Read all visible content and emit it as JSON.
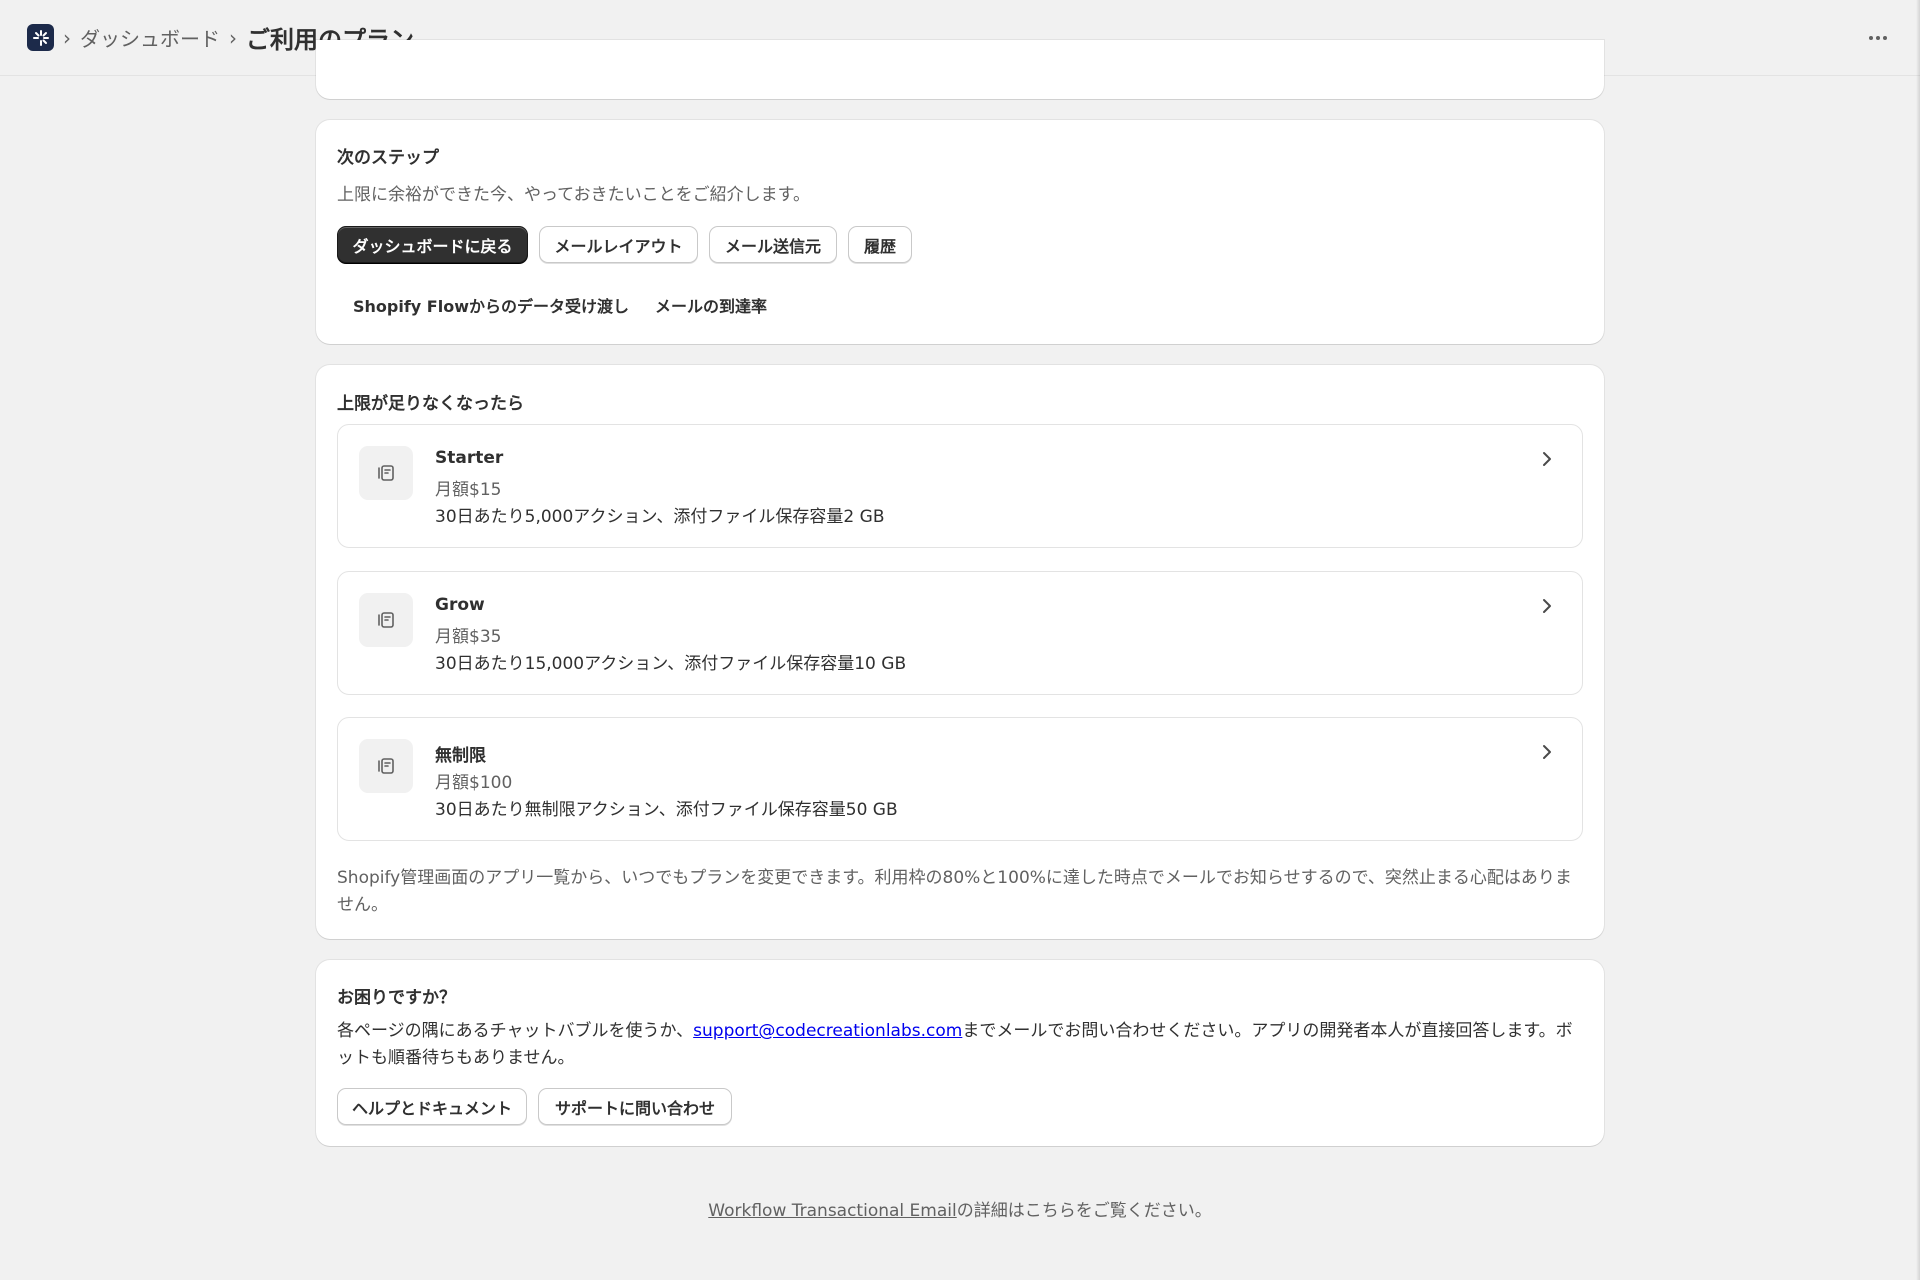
{
  "header": {
    "breadcrumb_parent": "ダッシュボード",
    "page_title": "ご利用のプラン"
  },
  "next_steps": {
    "title": "次のステップ",
    "subtitle": "上限に余裕ができた今、やっておきたいことをご紹介します。",
    "buttons": [
      "ダッシュボードに戻る",
      "メールレイアウト",
      "メール送信元",
      "履歴"
    ],
    "links": [
      "Shopify Flowからのデータ受け渡し",
      "メールの到達率"
    ]
  },
  "upgrade": {
    "title": "上限が足りなくなったら",
    "plans": [
      {
        "name": "Starter",
        "price": "月額$15",
        "desc": "30日あたり5,000アクション、添付ファイル保存容量2 GB"
      },
      {
        "name": "Grow",
        "price": "月額$35",
        "desc": "30日あたり15,000アクション、添付ファイル保存容量10 GB"
      },
      {
        "name": "無制限",
        "price": "月額$100",
        "desc": "30日あたり無制限アクション、添付ファイル保存容量50 GB"
      }
    ],
    "note": "Shopify管理画面のアプリ一覧から、いつでもプランを変更できます。利用枠の80%と100%に達した時点でメールでお知らせするので、突然止まる心配はありません。"
  },
  "help": {
    "title": "お困りですか？",
    "text_before": "各ページの隅にあるチャットバブルを使うか、",
    "email": "support@codecreationlabs.com",
    "text_after": "までメールでお問い合わせください。アプリの開発者本人が直接回答します。ボットも順番待ちもありません。",
    "buttons": [
      "ヘルプとドキュメント",
      "サポートに問い合わせ"
    ]
  },
  "footer": {
    "link": "Workflow Transactional Email",
    "text": "の詳細はこちらをご覧ください。"
  }
}
